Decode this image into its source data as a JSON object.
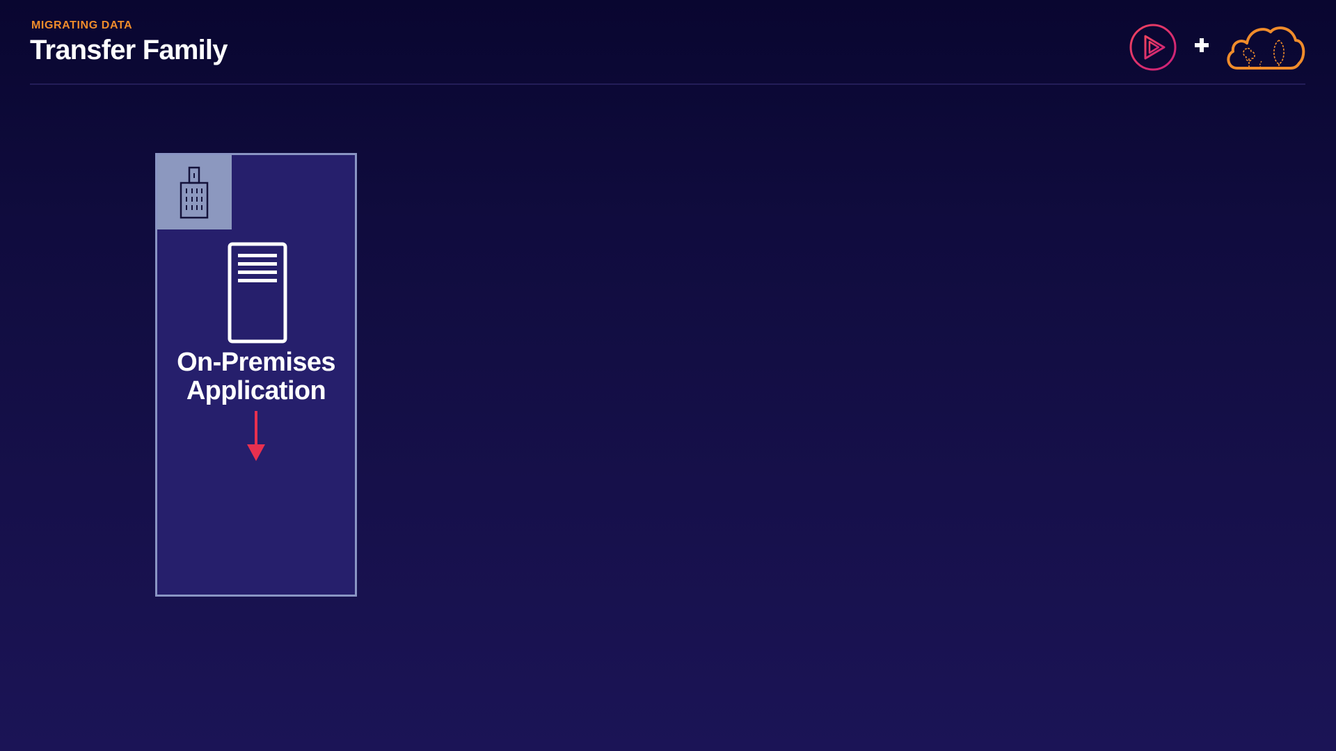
{
  "header": {
    "eyebrow": "MIGRATING DATA",
    "title": "Transfer Family"
  },
  "logos": {
    "play_logo_icon": "play-circle-icon",
    "plus_icon": "plus-icon",
    "cloud_logo_icon": "cloud-trees-icon"
  },
  "diagram": {
    "on_prem_box": {
      "corner_icon": "building-icon",
      "server_icon": "server-icon",
      "label_line1": "On-Premises",
      "label_line2": "Application",
      "arrow_icon": "arrow-down-icon"
    }
  },
  "colors": {
    "eyebrow": "#f08c2b",
    "title": "#ffffff",
    "background_top": "#090630",
    "background_bottom": "#1b1456",
    "box_fill": "#261f6c",
    "box_border": "#8a95c4",
    "building_tab": "#8c98bf",
    "play_logo": "#e32d6a",
    "cloud_logo": "#f08c2b",
    "arrow": "#e8304f"
  }
}
